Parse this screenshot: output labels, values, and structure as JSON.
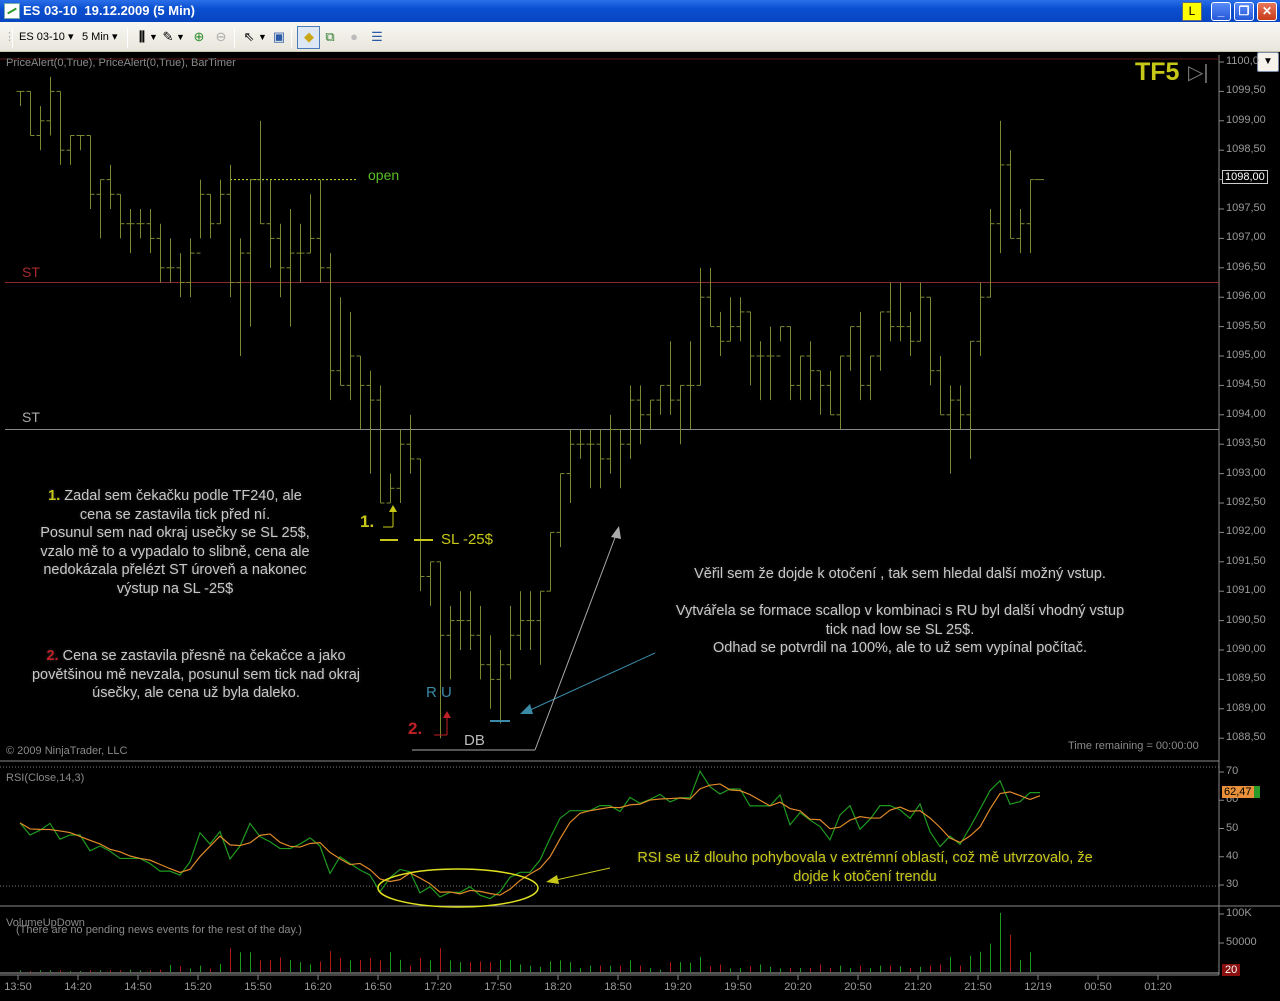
{
  "window": {
    "title": "ES 03-10  19.12.2009 (5 Min)",
    "link_button": "L"
  },
  "toolbar": {
    "instrument": "ES 03-10",
    "interval": "5 Min",
    "dropdown_arrow": "▾"
  },
  "indicators_label": "PriceAlert(0,True), PriceAlert(0,True), BarTimer",
  "tf_label": "TF5",
  "copyright": "© 2009 NinjaTrader, LLC",
  "time_remaining": "Time remaining = 00:00:00",
  "news_text": "(There are no pending news events for the rest of the day.)",
  "annotations": {
    "st_upper": "ST",
    "st_lower": "ST",
    "open": "open",
    "one": "1.",
    "two": "2.",
    "sl": "SL -25$",
    "ru": "R U",
    "db": "DB",
    "note1_num": "1.",
    "note1": "Zadal sem čekačku podle TF240, ale\ncena se zastavila tick před ní.\nPosunul sem nad okraj usečky se SL 25$,\nvzalo mě to a vypadalo to slibně, cena ale\nnedokázala přelézt ST úroveň a nakonec\nvýstup na SL -25$",
    "note2_num": "2.",
    "note2": "Cena se zastavila přesně na čekačce a jako\npovětšinou mě nevzala, posunul sem tick nad okraj\núsečky, ale cena už byla daleko.",
    "note3": "Věřil sem že dojde k otočení , tak sem hledal další možný vstup.\n\nVytvářela se formace scallop v kombinaci s RU byl další vhodný vstup\ntick nad low se SL 25$.\nOdhad se potvrdil na 100%, ale to už sem vypínal počítač.",
    "note_rsi": "RSI se už dlouho pohybovala v extrémní oblastí, což mě utvrzovalo, že\ndojde k otočení trendu"
  },
  "colors": {
    "bar": "#7a8a30",
    "st_upper": "#8b2a2a",
    "st_lower": "#8a8a8a",
    "rsi": "#1f9a1f",
    "rsi_avg": "#e08a2a",
    "vol_up": "#1f9a1f",
    "vol_down": "#b01818",
    "highlight": "#c8c818",
    "ru": "#3a8aa8"
  },
  "chart_data": [
    {
      "type": "ohlc",
      "title": "ES 03-10 (5 Min)",
      "ylim": [
        1088.5,
        1100
      ],
      "y_ticks": [
        "1100,0",
        "1099,50",
        "1099,00",
        "1098,50",
        "1098,00",
        "1097,50",
        "1097,00",
        "1096,50",
        "1096,00",
        "1095,50",
        "1095,00",
        "1094,50",
        "1094,00",
        "1093,50",
        "1093,00",
        "1092,50",
        "1092,00",
        "1091,50",
        "1091,00",
        "1090,50",
        "1090,00",
        "1089,50",
        "1089,00",
        "1088,50"
      ],
      "x_ticks": [
        "13:50",
        "14:20",
        "14:50",
        "15:20",
        "15:50",
        "16:20",
        "16:50",
        "17:20",
        "17:50",
        "18:20",
        "18:50",
        "19:20",
        "19:50",
        "20:20",
        "20:50",
        "21:20",
        "21:50",
        "12/19",
        "00:50",
        "01:20"
      ],
      "last_price": "1098,00",
      "hlines": [
        {
          "label": "ST",
          "price": 1096.25
        },
        {
          "label": "ST",
          "price": 1093.75
        },
        {
          "label": "PriceAlert",
          "price": 1100
        }
      ],
      "open_level": 1098.0,
      "bars_hlc": [
        [
          1099.5,
          1099.25,
          1099.5
        ],
        [
          1099.5,
          1098.75,
          1098.75
        ],
        [
          1099.25,
          1098.5,
          1099.0
        ],
        [
          1099.75,
          1098.75,
          1099.5
        ],
        [
          1099.5,
          1098.25,
          1098.5
        ],
        [
          1098.75,
          1098.25,
          1098.75
        ],
        [
          1098.75,
          1098.5,
          1098.75
        ],
        [
          1098.75,
          1097.5,
          1097.75
        ],
        [
          1098.0,
          1097.0,
          1098.0
        ],
        [
          1098.25,
          1097.5,
          1097.75
        ],
        [
          1097.75,
          1097.0,
          1097.25
        ],
        [
          1097.5,
          1096.75,
          1097.25
        ],
        [
          1097.5,
          1097.0,
          1097.25
        ],
        [
          1097.5,
          1096.75,
          1097.0
        ],
        [
          1097.25,
          1096.25,
          1096.5
        ],
        [
          1097.0,
          1096.25,
          1096.5
        ],
        [
          1096.75,
          1096.0,
          1096.25
        ],
        [
          1097.0,
          1096.0,
          1096.75
        ],
        [
          1098.0,
          1097.0,
          1097.75
        ],
        [
          1097.75,
          1097.0,
          1097.25
        ],
        [
          1098.0,
          1097.25,
          1097.75
        ],
        [
          1098.25,
          1096.0,
          1096.25
        ],
        [
          1097.0,
          1095.0,
          1096.75
        ],
        [
          1098.0,
          1095.5,
          1098.0
        ],
        [
          1099.0,
          1097.25,
          1097.25
        ],
        [
          1098.0,
          1096.5,
          1097.0
        ],
        [
          1097.25,
          1096.0,
          1096.5
        ],
        [
          1097.5,
          1095.5,
          1096.75
        ],
        [
          1097.25,
          1096.25,
          1096.75
        ],
        [
          1097.75,
          1096.75,
          1097.0
        ],
        [
          1098.0,
          1096.25,
          1096.5
        ],
        [
          1096.75,
          1094.25,
          1094.75
        ],
        [
          1096.0,
          1094.5,
          1094.5
        ],
        [
          1095.75,
          1094.25,
          1095.0
        ],
        [
          1095.0,
          1093.75,
          1094.5
        ],
        [
          1094.75,
          1093.0,
          1094.25
        ],
        [
          1094.5,
          1092.5,
          1092.5
        ],
        [
          1093.0,
          1092.5,
          1092.75
        ],
        [
          1093.75,
          1092.5,
          1093.5
        ],
        [
          1094.0,
          1093.0,
          1093.25
        ],
        [
          1093.25,
          1091.0,
          1091.25
        ],
        [
          1091.5,
          1090.75,
          1091.5
        ],
        [
          1091.5,
          1088.5,
          1090.25
        ],
        [
          1090.75,
          1089.5,
          1090.5
        ],
        [
          1091.0,
          1090.0,
          1090.5
        ],
        [
          1091.0,
          1090.0,
          1090.25
        ],
        [
          1090.75,
          1089.5,
          1089.75
        ],
        [
          1090.25,
          1089.0,
          1089.5
        ],
        [
          1090.0,
          1088.75,
          1089.75
        ],
        [
          1090.75,
          1089.5,
          1090.25
        ],
        [
          1091.0,
          1090.0,
          1090.5
        ],
        [
          1091.0,
          1090.0,
          1090.5
        ],
        [
          1091.0,
          1089.75,
          1091.0
        ],
        [
          1092.0,
          1091.0,
          1092.0
        ],
        [
          1093.0,
          1091.75,
          1093.0
        ],
        [
          1093.75,
          1092.5,
          1093.5
        ],
        [
          1093.75,
          1093.25,
          1093.5
        ],
        [
          1093.75,
          1092.75,
          1093.5
        ],
        [
          1093.75,
          1092.75,
          1093.25
        ],
        [
          1094.0,
          1093.0,
          1093.75
        ],
        [
          1093.75,
          1092.75,
          1093.5
        ],
        [
          1094.5,
          1093.25,
          1094.25
        ],
        [
          1094.5,
          1093.5,
          1094.0
        ],
        [
          1094.25,
          1093.75,
          1094.25
        ],
        [
          1094.5,
          1094.0,
          1094.5
        ],
        [
          1095.25,
          1094.0,
          1094.25
        ],
        [
          1094.5,
          1093.5,
          1094.5
        ],
        [
          1095.25,
          1093.75,
          1094.5
        ],
        [
          1096.5,
          1094.5,
          1096.0
        ],
        [
          1096.5,
          1095.5,
          1095.5
        ],
        [
          1095.75,
          1095.0,
          1095.25
        ],
        [
          1096.0,
          1095.25,
          1095.5
        ],
        [
          1096.0,
          1095.25,
          1095.75
        ],
        [
          1095.75,
          1094.5,
          1095.0
        ],
        [
          1095.25,
          1094.25,
          1095.0
        ],
        [
          1095.5,
          1094.25,
          1095.0
        ],
        [
          1095.5,
          1095.25,
          1095.5
        ],
        [
          1095.5,
          1094.25,
          1094.5
        ],
        [
          1095.0,
          1094.25,
          1095.0
        ],
        [
          1095.25,
          1094.25,
          1094.75
        ],
        [
          1094.75,
          1094.0,
          1094.5
        ],
        [
          1094.75,
          1094.0,
          1094.0
        ],
        [
          1095.0,
          1093.75,
          1095.0
        ],
        [
          1095.5,
          1094.75,
          1095.5
        ],
        [
          1095.75,
          1094.25,
          1094.5
        ],
        [
          1095.0,
          1094.25,
          1095.0
        ],
        [
          1095.75,
          1094.75,
          1095.75
        ],
        [
          1096.25,
          1095.25,
          1095.5
        ],
        [
          1096.25,
          1095.25,
          1095.5
        ],
        [
          1095.75,
          1095.0,
          1095.25
        ],
        [
          1096.25,
          1095.25,
          1096.0
        ],
        [
          1096.0,
          1094.5,
          1094.75
        ],
        [
          1095.0,
          1094.0,
          1094.0
        ],
        [
          1094.5,
          1093.0,
          1094.25
        ],
        [
          1094.5,
          1093.75,
          1094.0
        ],
        [
          1095.25,
          1093.25,
          1095.25
        ],
        [
          1096.25,
          1095.0,
          1096.0
        ],
        [
          1097.5,
          1096.0,
          1097.25
        ],
        [
          1099.0,
          1096.75,
          1098.25
        ],
        [
          1098.5,
          1097.0,
          1097.0
        ],
        [
          1097.5,
          1096.75,
          1097.25
        ],
        [
          1098.0,
          1096.75,
          1098.0
        ]
      ]
    },
    {
      "type": "line",
      "title": "RSI(Close,14,3)",
      "ylim": [
        30,
        70
      ],
      "y_ticks": [
        "70",
        "60",
        "50",
        "40",
        "30"
      ],
      "last_value": "62,47",
      "series": [
        {
          "name": "RSI",
          "values": [
            52,
            47.7,
            49.4,
            51.8,
            46.2,
            47.7,
            47.7,
            42.1,
            43.8,
            42,
            39.4,
            39.4,
            39.4,
            37.6,
            34.9,
            34.9,
            33.5,
            38.2,
            48.5,
            44.5,
            48.9,
            39.2,
            43.8,
            51.8,
            47.1,
            45.3,
            42.9,
            42.9,
            44.5,
            46.7,
            43.8,
            34.1,
            40,
            37.6,
            35.3,
            33.5,
            27.6,
            32.6,
            35.5,
            34.7,
            27.2,
            29.4,
            25.8,
            27.4,
            27.4,
            29.4,
            26.4,
            25.2,
            27.6,
            32.7,
            34.5,
            34.5,
            38.8,
            46.5,
            53.6,
            56.3,
            56.3,
            56.3,
            58.1,
            58.1,
            56,
            61,
            58.9,
            60.3,
            62.1,
            59.4,
            60.9,
            60.9,
            70.3,
            64.8,
            62.2,
            64,
            64,
            58,
            58,
            58,
            61.9,
            51.3,
            55.6,
            53,
            50.7,
            46,
            54.8,
            58.1,
            49.7,
            53.3,
            58.1,
            58.1,
            56.6,
            53.6,
            58.7,
            48.9,
            43.6,
            47.3,
            44.4,
            50.4,
            56.8,
            63.4,
            66.9,
            58.6,
            59.5,
            62.7,
            62.7
          ]
        },
        {
          "name": "Avg",
          "smoothing": 3
        }
      ]
    },
    {
      "type": "bar",
      "title": "VolumeUpDown",
      "unit": "K",
      "y_ticks": [
        "100K",
        "50000"
      ],
      "last_value": "20",
      "values": [
        3,
        2,
        3,
        3,
        3,
        2,
        2,
        3,
        3,
        3,
        3,
        4,
        3,
        3,
        4,
        12,
        10,
        6,
        11,
        6,
        14,
        41,
        34,
        34,
        20,
        21,
        25,
        21,
        17,
        13,
        18,
        36,
        24,
        20,
        21,
        24,
        20,
        34,
        21,
        11,
        24,
        20,
        41,
        20,
        17,
        17,
        18,
        17,
        21,
        21,
        13,
        11,
        9,
        18,
        20,
        17,
        7,
        11,
        11,
        11,
        11,
        20,
        11,
        7,
        4,
        17,
        17,
        16,
        26,
        10,
        13,
        6,
        7,
        10,
        13,
        9,
        6,
        7,
        7,
        7,
        13,
        7,
        11,
        7,
        11,
        7,
        11,
        11,
        10,
        7,
        9,
        11,
        13,
        26,
        11,
        28,
        35,
        49,
        102,
        64,
        21,
        34
      ]
    }
  ]
}
